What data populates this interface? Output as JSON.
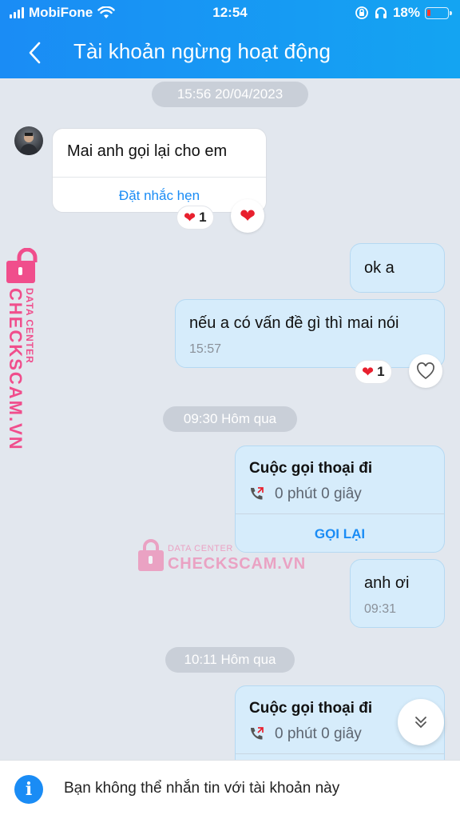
{
  "status_bar": {
    "carrier": "MobiFone",
    "time": "12:54",
    "battery_percent": "18%",
    "battery_level": 0.18
  },
  "header": {
    "title": "Tài khoản ngừng hoạt động"
  },
  "chat": {
    "timestamps": [
      "15:56 20/04/2023",
      "09:30 Hôm qua",
      "10:11 Hôm qua"
    ],
    "incoming_message": {
      "text": "Mai anh gọi lại cho em",
      "action": "Đặt nhắc hẹn",
      "reaction_count": "1"
    },
    "outgoing_1": {
      "text": "ok a"
    },
    "outgoing_2": {
      "text": "nếu a có vấn đề gì thì mai nói",
      "time": "15:57",
      "reaction_count": "1"
    },
    "call_1": {
      "title": "Cuộc gọi thoại đi",
      "duration": "0 phút 0 giây",
      "action": "GỌI LẠI"
    },
    "outgoing_3": {
      "text": "anh ơi",
      "time": "09:31"
    },
    "call_2": {
      "title": "Cuộc gọi thoại đi",
      "duration": "0 phút 0 giây"
    }
  },
  "watermark": {
    "small": "DATA CENTER",
    "big": "CHECKSCAM.VN"
  },
  "footer": {
    "text": "Bạn không thể nhắn tin với tài khoản này"
  },
  "colors": {
    "header_blue": "#1a8cf5",
    "chat_bg": "#e2e7ee",
    "outgoing_bubble": "#d6ecfb",
    "watermark_pink": "#f04e8c"
  }
}
